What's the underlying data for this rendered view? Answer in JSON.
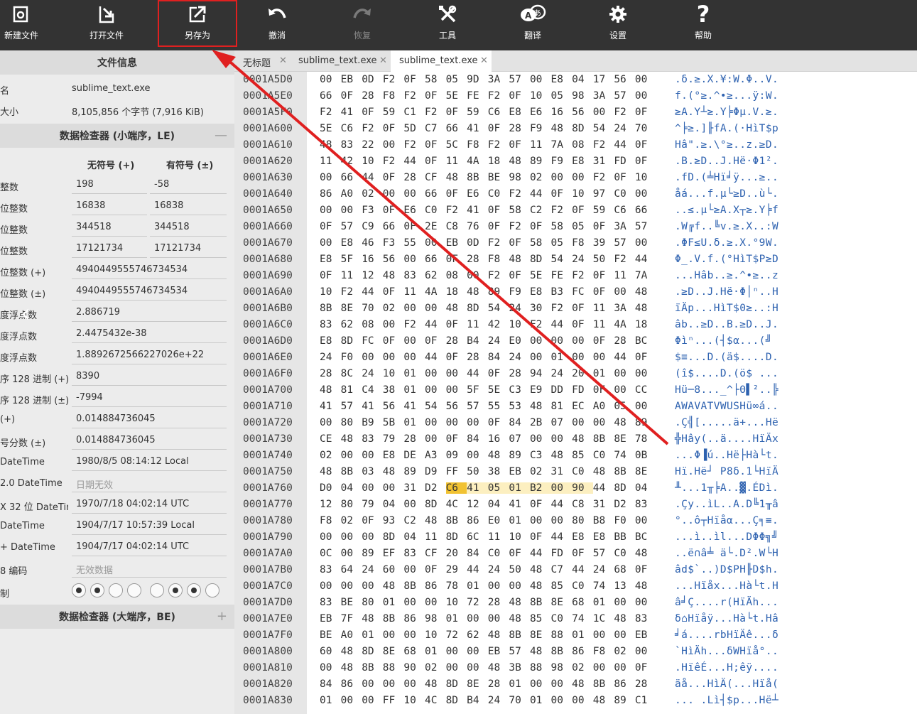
{
  "toolbar": {
    "buttons": [
      {
        "id": "new",
        "label": "新建文件",
        "icon": "new-file-icon"
      },
      {
        "id": "open",
        "label": "打开文件",
        "icon": "open-file-icon"
      },
      {
        "id": "saveas",
        "label": "另存为",
        "icon": "save-as-icon"
      },
      {
        "id": "undo",
        "label": "撤消",
        "icon": "undo-icon"
      },
      {
        "id": "redo",
        "label": "恢复",
        "icon": "redo-icon",
        "disabled": true
      },
      {
        "id": "tools",
        "label": "工具",
        "icon": "tools-icon"
      },
      {
        "id": "translate",
        "label": "翻译",
        "icon": "translate-icon"
      },
      {
        "id": "settings",
        "label": "设置",
        "icon": "gear-icon"
      },
      {
        "id": "help",
        "label": "帮助",
        "icon": "help-icon"
      }
    ]
  },
  "file_info": {
    "title": "文件信息",
    "name_label": "名",
    "name_value": "sublime_text.exe",
    "size_label": "大小",
    "size_value": "8,105,856 个字节 (7,916 KiB)"
  },
  "inspector_le": {
    "title": "数据检查器 (小端序，LE)",
    "toggle": "—",
    "col_unsigned": "无符号 (+)",
    "col_signed": "有符号 (±)",
    "rows2": [
      {
        "label": "整数",
        "unsigned": "198",
        "signed": "-58"
      },
      {
        "label": "位整数",
        "unsigned": "16838",
        "signed": "16838"
      },
      {
        "label": "位整数",
        "unsigned": "344518",
        "signed": "344518"
      },
      {
        "label": "位整数",
        "unsigned": "17121734",
        "signed": "17121734"
      }
    ],
    "rows1": [
      {
        "label": "位整数 (+)",
        "value": "4940449555746734534"
      },
      {
        "label": "位整数 (±)",
        "value": "4940449555746734534"
      },
      {
        "label": "度浮点数",
        "value": "2.886719"
      },
      {
        "label": "度浮点数",
        "value": "2.4475432e-38"
      },
      {
        "label": "度浮点数",
        "value": "1.8892672566227026e+22"
      },
      {
        "label": "序 128 进制 (+)",
        "value": "8390"
      },
      {
        "label": "序 128 进制 (±)",
        "value": "-7994"
      },
      {
        "label": "(+)",
        "value": "0.014884736045"
      },
      {
        "label": "号分数 (±)",
        "value": "0.014884736045"
      },
      {
        "label": "DateTime",
        "value": "1980/8/5 08:14:12 Local"
      },
      {
        "label": "2.0 DateTime",
        "value": "日期无效",
        "muted": true
      },
      {
        "label": "X 32 位 DateTime",
        "value": "1970/7/18 04:02:14 UTC"
      },
      {
        "label": "DateTime",
        "value": "1904/7/17 10:57:39 Local"
      },
      {
        "label": "+ DateTime",
        "value": "1904/7/17 04:02:14 UTC"
      },
      {
        "label": "8 编码",
        "value": "无效数据",
        "muted": true
      }
    ],
    "binary_label": "制",
    "bits": [
      true,
      true,
      false,
      false,
      false,
      true,
      true,
      false
    ]
  },
  "inspector_be": {
    "title": "数据检查器 (大端序，BE)",
    "toggle": "+"
  },
  "tabs": [
    {
      "label": "无标题",
      "close": "✕"
    },
    {
      "label": "sublime_text.exe",
      "close": "✕"
    },
    {
      "label": "sublime_text.exe",
      "close": "✕",
      "active": true
    }
  ],
  "hex": {
    "rows": [
      {
        "offset": "0001A5D0",
        "bytes": "00 EB 0D F2 0F 58 05 9D 3A 57 00 E8 04 17 56 00",
        "ascii": ".δ.≥.X.¥:W.Φ..V."
      },
      {
        "offset": "0001A5E0",
        "bytes": "66 0F 28 F8 F2 0F 5E FE F2 0F 10 05 98 3A 57 00",
        "ascii": "f.(°≥.^•≥...ÿ:W."
      },
      {
        "offset": "0001A5F0",
        "bytes": "F2 41 0F 59 C1 F2 0F 59 C6 E8 E6 16 56 00 F2 0F",
        "ascii": "≥A.Y┴≥.Y╞Φµ.V.≥."
      },
      {
        "offset": "0001A600",
        "bytes": "5E C6 F2 0F 5D C7 66 41 0F 28 F9 48 8D 54 24 70",
        "ascii": "^╞≥.]╟fA.(·HìT$p"
      },
      {
        "offset": "0001A610",
        "bytes": "48 83 22 00 F2 0F 5C F8 F2 0F 11 7A 08 F2 44 0F",
        "ascii": "Hâ\".≥.\\°≥..z.≥D."
      },
      {
        "offset": "0001A620",
        "bytes": "11 42 10 F2 44 0F 11 4A 18 48 89 F9 E8 31 FD 0F",
        "ascii": ".B.≥D..J.Hë·Φ1².",
        "note": ""
      },
      {
        "offset": "0001A630",
        "bytes": "00 66 44 0F 28 CF 48 8B BE 98 02 00 00 F2 0F 10",
        "ascii": ".fD.(╧Hï╛ÿ...≥.."
      },
      {
        "offset": "0001A640",
        "bytes": "86 A0 02 00 00 66 0F E6 C0 F2 44 0F 10 97 C0 00",
        "ascii": "åá...f.µ└≥D..ù└."
      },
      {
        "offset": "0001A650",
        "bytes": "00 00 F3 0F E6 C0 F2 41 0F 58 C2 F2 0F 59 C6 66",
        "ascii": "..≤.µ└≥A.X┬≥.Y╞f"
      },
      {
        "offset": "0001A660",
        "bytes": "0F 57 C9 66 0F 2E C8 76 0F F2 0F 58 05 0F 3A 57",
        "ascii": ".W╔f..╚v.≥.X..:W"
      },
      {
        "offset": "0001A670",
        "bytes": "00 E8 46 F3 55 00 EB 0D F2 0F 58 05 F8 39 57 00",
        "ascii": ".ΦF≤U.δ.≥.X.°9W."
      },
      {
        "offset": "0001A680",
        "bytes": "E8 5F 16 56 00 66 0F 28 F8 48 8D 54 24 50 F2 44",
        "ascii": "Φ_.V.f.(°HìT$P≥D"
      },
      {
        "offset": "0001A690",
        "bytes": "0F 11 12 48 83 62 08 00 F2 0F 5E FE F2 0F 11 7A",
        "ascii": "...Hâb..≥.^•≥..z"
      },
      {
        "offset": "0001A6A0",
        "bytes": "10 F2 44 0F 11 4A 18 48 89 F9 E8 B3 FC 0F 00 48",
        "ascii": ".≥D..J.Hë·Φ│ⁿ..H"
      },
      {
        "offset": "0001A6B0",
        "bytes": "8B 8E 70 02 00 00 48 8D 54 24 30 F2 0F 11 3A 48",
        "ascii": "ïÄp...HìT$0≥..:H"
      },
      {
        "offset": "0001A6C0",
        "bytes": "83 62 08 00 F2 44 0F 11 42 10 F2 44 0F 11 4A 18",
        "ascii": "âb..≥D..B.≥D..J."
      },
      {
        "offset": "0001A6D0",
        "bytes": "E8 8D FC 0F 00 0F 28 B4 24 E0 00 00 00 0F 28 BC",
        "ascii": "Φìⁿ...(┤$α...(╝"
      },
      {
        "offset": "0001A6E0",
        "bytes": "24 F0 00 00 00 44 0F 28 84 24 00 01 00 00 44 0F",
        "ascii": "$≡...D.(ä$....D."
      },
      {
        "offset": "0001A6F0",
        "bytes": "28 8C 24 10 01 00 00 44 0F 28 94 24 20 01 00 00",
        "ascii": "(î$....D.(ö$ ..."
      },
      {
        "offset": "0001A700",
        "bytes": "48 81 C4 38 01 00 00 5F 5E C3 E9 DD FD 0F 00 CC",
        "ascii": "Hü─8..._^├Θ▌²..╠"
      },
      {
        "offset": "0001A710",
        "bytes": "41 57 41 56 41 54 56 57 55 53 48 81 EC A0 05 00",
        "ascii": "AWAVATVWUSHü∞á.."
      },
      {
        "offset": "0001A720",
        "bytes": "00 80 B9 5B 01 00 00 00 0F 84 2B 07 00 00 48 89",
        "ascii": ".Ç╣[.....ä+...Hë"
      },
      {
        "offset": "0001A730",
        "bytes": "CE 48 83 79 28 00 0F 84 16 07 00 00 48 8B 8E 78",
        "ascii": "╬Hây(..ä....HïÄx"
      },
      {
        "offset": "0001A740",
        "bytes": "02 00 00 E8 DE A3 09 00 48 89 C3 48 85 C0 74 0B",
        "ascii": "...Φ▐ú..Hë├Hà└t."
      },
      {
        "offset": "0001A750",
        "bytes": "48 8B 03 48 89 D9 FF 50 38 EB 02 31 C0 48 8B 8E",
        "ascii": "Hï.Hë┘ P8δ.1└HïÄ"
      },
      {
        "offset": "0001A760",
        "bytes": "D0 04 00 00 31 D2 C6 41 05 01 B2 00 90 44 8D 04",
        "ascii": "╨...1╥╞A..▓.ÉDì.",
        "highlight": true
      },
      {
        "offset": "0001A770",
        "bytes": "12 80 79 04 00 8D 4C 12 04 41 0F 44 C8 31 D2 83",
        "ascii": ".Çy..ìL..A.D╚1╥â"
      },
      {
        "offset": "0001A780",
        "bytes": "F8 02 0F 93 C2 48 8B 86 E0 01 00 00 80 B8 F0 00",
        "ascii": "°..ô┬Hïåα...Ç╕≡."
      },
      {
        "offset": "0001A790",
        "bytes": "00 00 00 8D 04 11 8D 6C 11 10 0F 44 E8 E8 BB BC",
        "ascii": "...ì..ìl...DΦΦ╗╝"
      },
      {
        "offset": "0001A7A0",
        "bytes": "0C 00 89 EF 83 CF 20 84 C0 0F 44 FD 0F 57 C0 48",
        "ascii": "..ë∩â╧ ä└.D².W└H"
      },
      {
        "offset": "0001A7B0",
        "bytes": "83 64 24 60 00 0F 29 44 24 50 48 C7 44 24 68 0F",
        "ascii": "âd$`..)D$PH╟D$h."
      },
      {
        "offset": "0001A7C0",
        "bytes": "00 00 00 48 8B 86 78 01 00 00 48 85 C0 74 13 48",
        "ascii": "...Hïåx...Hà└t.H"
      },
      {
        "offset": "0001A7D0",
        "bytes": "83 BE 80 01 00 00 10 72 28 48 8B 8E 68 01 00 00",
        "ascii": "â╛Ç....r(HïÄh..."
      },
      {
        "offset": "0001A7E0",
        "bytes": "EB 7F 48 8B 86 98 01 00 00 48 85 C0 74 1C 48 83",
        "ascii": "δ⌂Hïåÿ...Hà└t.Hâ"
      },
      {
        "offset": "0001A7F0",
        "bytes": "BE A0 01 00 00 10 72 62 48 8B 8E 88 01 00 00 EB",
        "ascii": "╛á....rbHïÄê...δ"
      },
      {
        "offset": "0001A800",
        "bytes": "60 48 8D 8E 68 01 00 00 EB 57 48 8B 86 F8 02 00",
        "ascii": "`HìÄh...δWHïå°.."
      },
      {
        "offset": "0001A810",
        "bytes": "00 48 8B 88 90 02 00 00 48 3B 88 98 02 00 00 0F",
        "ascii": ".HïêÉ...H;êÿ...."
      },
      {
        "offset": "0001A820",
        "bytes": "84 86 00 00 00 48 8D 8E 28 01 00 00 48 8B 86 28",
        "ascii": "äå...HìÄ(...Hïå("
      },
      {
        "offset": "0001A830",
        "bytes": "01 00 00 FF 10 4C 8D B4 24 70 01 00 00 48 89 C1",
        "ascii": "... .Lì┤$p...Hë┴"
      }
    ]
  }
}
